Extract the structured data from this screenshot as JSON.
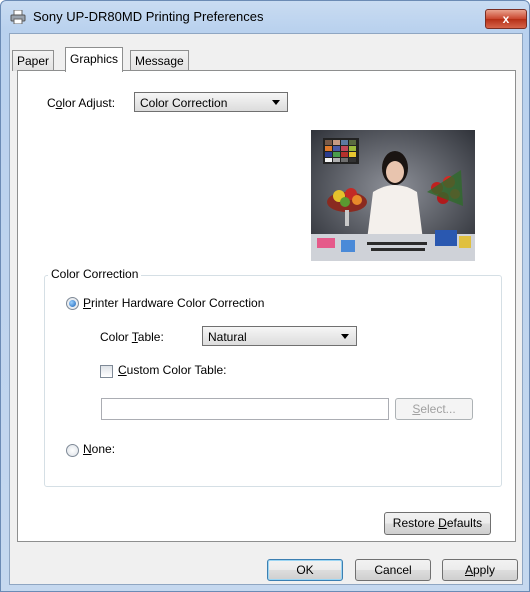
{
  "window": {
    "title": "Sony UP-DR80MD Printing Preferences",
    "close_label": "x"
  },
  "tabs": [
    {
      "label": "Paper",
      "active": false
    },
    {
      "label": "Graphics",
      "active": true
    },
    {
      "label": "Message",
      "active": false
    }
  ],
  "graphics": {
    "color_adjust_label": "Color Adjust:",
    "color_adjust_value": "Color Correction"
  },
  "color_correction": {
    "group_title": "Color Correction",
    "printer_hw_label": "Printer Hardware Color Correction",
    "printer_hw_selected": true,
    "color_table_label": "Color Table:",
    "color_table_value": "Natural",
    "custom_table_label": "Custom Color Table:",
    "custom_table_checked": false,
    "custom_table_path": "",
    "select_label": "Select...",
    "none_label": "None:",
    "none_selected": false
  },
  "buttons": {
    "restore_defaults": "Restore Defaults",
    "ok": "OK",
    "cancel": "Cancel",
    "apply": "Apply"
  },
  "icons": {
    "title": "printer-icon"
  }
}
